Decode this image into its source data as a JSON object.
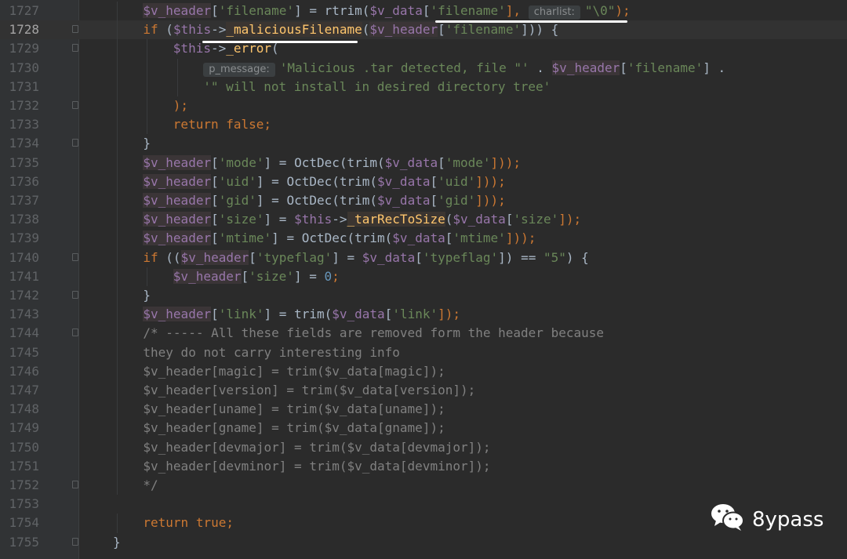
{
  "watermark": {
    "text": "8ypass",
    "icon": "wechat-icon"
  },
  "colors": {
    "background": "#2b2b2b",
    "gutter": "#313335",
    "keyword": "#cc7832",
    "variable": "#9876aa",
    "string": "#6a8759",
    "number": "#6897bb",
    "function": "#ffc66d",
    "comment": "#808080",
    "default": "#a9b7c6"
  },
  "current_line": 1728,
  "lines": [
    {
      "n": "1727",
      "indent": 2,
      "fold": false,
      "tokens": [
        {
          "t": "$v_header",
          "c": "var",
          "h": "var"
        },
        {
          "t": "[",
          "c": "default"
        },
        {
          "t": "'filename'",
          "c": "str"
        },
        {
          "t": "] = rtrim(",
          "c": "default"
        },
        {
          "t": "$v_data",
          "c": "var"
        },
        {
          "t": "[",
          "c": "default"
        },
        {
          "t": "'filename'",
          "c": "str"
        },
        {
          "t": "], ",
          "c": "kw"
        },
        {
          "t": "charlist:",
          "c": "hint"
        },
        {
          "t": "\"\\0\"",
          "c": "str"
        },
        {
          "t": ");",
          "c": "kw"
        }
      ]
    },
    {
      "n": "1728",
      "indent": 2,
      "fold": true,
      "tokens": [
        {
          "t": "if ",
          "c": "kw"
        },
        {
          "t": "(",
          "c": "default"
        },
        {
          "t": "$this",
          "c": "var"
        },
        {
          "t": "->",
          "c": "default"
        },
        {
          "t": "_maliciousFilename",
          "c": "fn",
          "h": "fn"
        },
        {
          "t": "(",
          "c": "default"
        },
        {
          "t": "$v_header",
          "c": "var",
          "h": "var"
        },
        {
          "t": "[",
          "c": "default"
        },
        {
          "t": "'filename'",
          "c": "str"
        },
        {
          "t": "])) {",
          "c": "default"
        }
      ]
    },
    {
      "n": "1729",
      "indent": 3,
      "fold": true,
      "tokens": [
        {
          "t": "$this",
          "c": "var"
        },
        {
          "t": "->",
          "c": "default"
        },
        {
          "t": "_error",
          "c": "fn"
        },
        {
          "t": "(",
          "c": "default"
        }
      ]
    },
    {
      "n": "1730",
      "indent": 4,
      "fold": false,
      "tokens": [
        {
          "t": "p_message:",
          "c": "hint"
        },
        {
          "t": "'Malicious .tar detected, file \"'",
          "c": "str"
        },
        {
          "t": " . ",
          "c": "default"
        },
        {
          "t": "$v_header",
          "c": "var",
          "h": "var"
        },
        {
          "t": "[",
          "c": "default"
        },
        {
          "t": "'filename'",
          "c": "str"
        },
        {
          "t": "] .",
          "c": "default"
        }
      ]
    },
    {
      "n": "1731",
      "indent": 4,
      "fold": false,
      "tokens": [
        {
          "t": "'\" will not install in desired directory tree'",
          "c": "str"
        }
      ]
    },
    {
      "n": "1732",
      "indent": 3,
      "fold": true,
      "tokens": [
        {
          "t": ");",
          "c": "kw"
        }
      ]
    },
    {
      "n": "1733",
      "indent": 3,
      "fold": false,
      "tokens": [
        {
          "t": "return false;",
          "c": "kw"
        }
      ]
    },
    {
      "n": "1734",
      "indent": 2,
      "fold": true,
      "tokens": [
        {
          "t": "}",
          "c": "default"
        }
      ]
    },
    {
      "n": "1735",
      "indent": 2,
      "fold": false,
      "tokens": [
        {
          "t": "$v_header",
          "c": "var",
          "h": "var"
        },
        {
          "t": "[",
          "c": "default"
        },
        {
          "t": "'mode'",
          "c": "str"
        },
        {
          "t": "] = OctDec(trim(",
          "c": "default"
        },
        {
          "t": "$v_data",
          "c": "var"
        },
        {
          "t": "[",
          "c": "default"
        },
        {
          "t": "'mode'",
          "c": "str"
        },
        {
          "t": "]));",
          "c": "kw"
        }
      ]
    },
    {
      "n": "1736",
      "indent": 2,
      "fold": false,
      "tokens": [
        {
          "t": "$v_header",
          "c": "var",
          "h": "var"
        },
        {
          "t": "[",
          "c": "default"
        },
        {
          "t": "'uid'",
          "c": "str"
        },
        {
          "t": "] = OctDec(trim(",
          "c": "default"
        },
        {
          "t": "$v_data",
          "c": "var"
        },
        {
          "t": "[",
          "c": "default"
        },
        {
          "t": "'uid'",
          "c": "str"
        },
        {
          "t": "]));",
          "c": "kw"
        }
      ]
    },
    {
      "n": "1737",
      "indent": 2,
      "fold": false,
      "tokens": [
        {
          "t": "$v_header",
          "c": "var",
          "h": "var"
        },
        {
          "t": "[",
          "c": "default"
        },
        {
          "t": "'gid'",
          "c": "str"
        },
        {
          "t": "] = OctDec(trim(",
          "c": "default"
        },
        {
          "t": "$v_data",
          "c": "var"
        },
        {
          "t": "[",
          "c": "default"
        },
        {
          "t": "'gid'",
          "c": "str"
        },
        {
          "t": "]));",
          "c": "kw"
        }
      ]
    },
    {
      "n": "1738",
      "indent": 2,
      "fold": false,
      "tokens": [
        {
          "t": "$v_header",
          "c": "var",
          "h": "var"
        },
        {
          "t": "[",
          "c": "default"
        },
        {
          "t": "'size'",
          "c": "str"
        },
        {
          "t": "] = ",
          "c": "default"
        },
        {
          "t": "$this",
          "c": "var"
        },
        {
          "t": "->",
          "c": "default"
        },
        {
          "t": "_tarRecToSize",
          "c": "fn",
          "h": "fn"
        },
        {
          "t": "(",
          "c": "default"
        },
        {
          "t": "$v_data",
          "c": "var"
        },
        {
          "t": "[",
          "c": "default"
        },
        {
          "t": "'size'",
          "c": "str"
        },
        {
          "t": "]);",
          "c": "kw"
        }
      ]
    },
    {
      "n": "1739",
      "indent": 2,
      "fold": false,
      "tokens": [
        {
          "t": "$v_header",
          "c": "var",
          "h": "var"
        },
        {
          "t": "[",
          "c": "default"
        },
        {
          "t": "'mtime'",
          "c": "str"
        },
        {
          "t": "] = OctDec(trim(",
          "c": "default"
        },
        {
          "t": "$v_data",
          "c": "var"
        },
        {
          "t": "[",
          "c": "default"
        },
        {
          "t": "'mtime'",
          "c": "str"
        },
        {
          "t": "]));",
          "c": "kw"
        }
      ]
    },
    {
      "n": "1740",
      "indent": 2,
      "fold": true,
      "tokens": [
        {
          "t": "if ",
          "c": "kw"
        },
        {
          "t": "((",
          "c": "default"
        },
        {
          "t": "$v_header",
          "c": "var",
          "h": "var"
        },
        {
          "t": "[",
          "c": "default"
        },
        {
          "t": "'typeflag'",
          "c": "str"
        },
        {
          "t": "] = ",
          "c": "default"
        },
        {
          "t": "$v_data",
          "c": "var"
        },
        {
          "t": "[",
          "c": "default"
        },
        {
          "t": "'typeflag'",
          "c": "str"
        },
        {
          "t": "]) == ",
          "c": "default"
        },
        {
          "t": "\"5\"",
          "c": "str"
        },
        {
          "t": ") {",
          "c": "default"
        }
      ]
    },
    {
      "n": "1741",
      "indent": 3,
      "fold": false,
      "tokens": [
        {
          "t": "$v_header",
          "c": "var",
          "h": "var"
        },
        {
          "t": "[",
          "c": "default"
        },
        {
          "t": "'size'",
          "c": "str"
        },
        {
          "t": "] = ",
          "c": "default"
        },
        {
          "t": "0",
          "c": "num"
        },
        {
          "t": ";",
          "c": "kw"
        }
      ]
    },
    {
      "n": "1742",
      "indent": 2,
      "fold": true,
      "tokens": [
        {
          "t": "}",
          "c": "default"
        }
      ]
    },
    {
      "n": "1743",
      "indent": 2,
      "fold": false,
      "tokens": [
        {
          "t": "$v_header",
          "c": "var",
          "h": "var"
        },
        {
          "t": "[",
          "c": "default"
        },
        {
          "t": "'link'",
          "c": "str"
        },
        {
          "t": "] = trim(",
          "c": "default"
        },
        {
          "t": "$v_data",
          "c": "var"
        },
        {
          "t": "[",
          "c": "default"
        },
        {
          "t": "'link'",
          "c": "str"
        },
        {
          "t": "]);",
          "c": "kw"
        }
      ]
    },
    {
      "n": "1744",
      "indent": 2,
      "fold": true,
      "tokens": [
        {
          "t": "/* ----- All these fields are removed form the header because",
          "c": "cm"
        }
      ]
    },
    {
      "n": "1745",
      "indent": 2,
      "fold": false,
      "tokens": [
        {
          "t": "they do not carry interesting info",
          "c": "cm"
        }
      ]
    },
    {
      "n": "1746",
      "indent": 2,
      "fold": false,
      "tokens": [
        {
          "t": "$v_header[magic] = trim($v_data[magic]);",
          "c": "cm"
        }
      ]
    },
    {
      "n": "1747",
      "indent": 2,
      "fold": false,
      "tokens": [
        {
          "t": "$v_header[version] = trim($v_data[version]);",
          "c": "cm"
        }
      ]
    },
    {
      "n": "1748",
      "indent": 2,
      "fold": false,
      "tokens": [
        {
          "t": "$v_header[uname] = trim($v_data[uname]);",
          "c": "cm"
        }
      ]
    },
    {
      "n": "1749",
      "indent": 2,
      "fold": false,
      "tokens": [
        {
          "t": "$v_header[gname] = trim($v_data[gname]);",
          "c": "cm"
        }
      ]
    },
    {
      "n": "1750",
      "indent": 2,
      "fold": false,
      "tokens": [
        {
          "t": "$v_header[devmajor] = trim($v_data[devmajor]);",
          "c": "cm"
        }
      ]
    },
    {
      "n": "1751",
      "indent": 2,
      "fold": false,
      "tokens": [
        {
          "t": "$v_header[devminor] = trim($v_data[devminor]);",
          "c": "cm"
        }
      ]
    },
    {
      "n": "1752",
      "indent": 2,
      "fold": true,
      "tokens": [
        {
          "t": "*/",
          "c": "cm"
        }
      ]
    },
    {
      "n": "1753",
      "indent": 0,
      "fold": false,
      "tokens": []
    },
    {
      "n": "1754",
      "indent": 2,
      "fold": false,
      "tokens": [
        {
          "t": "return true;",
          "c": "kw"
        }
      ]
    },
    {
      "n": "1755",
      "indent": 1,
      "fold": true,
      "tokens": [
        {
          "t": "}",
          "c": "default"
        }
      ]
    }
  ]
}
